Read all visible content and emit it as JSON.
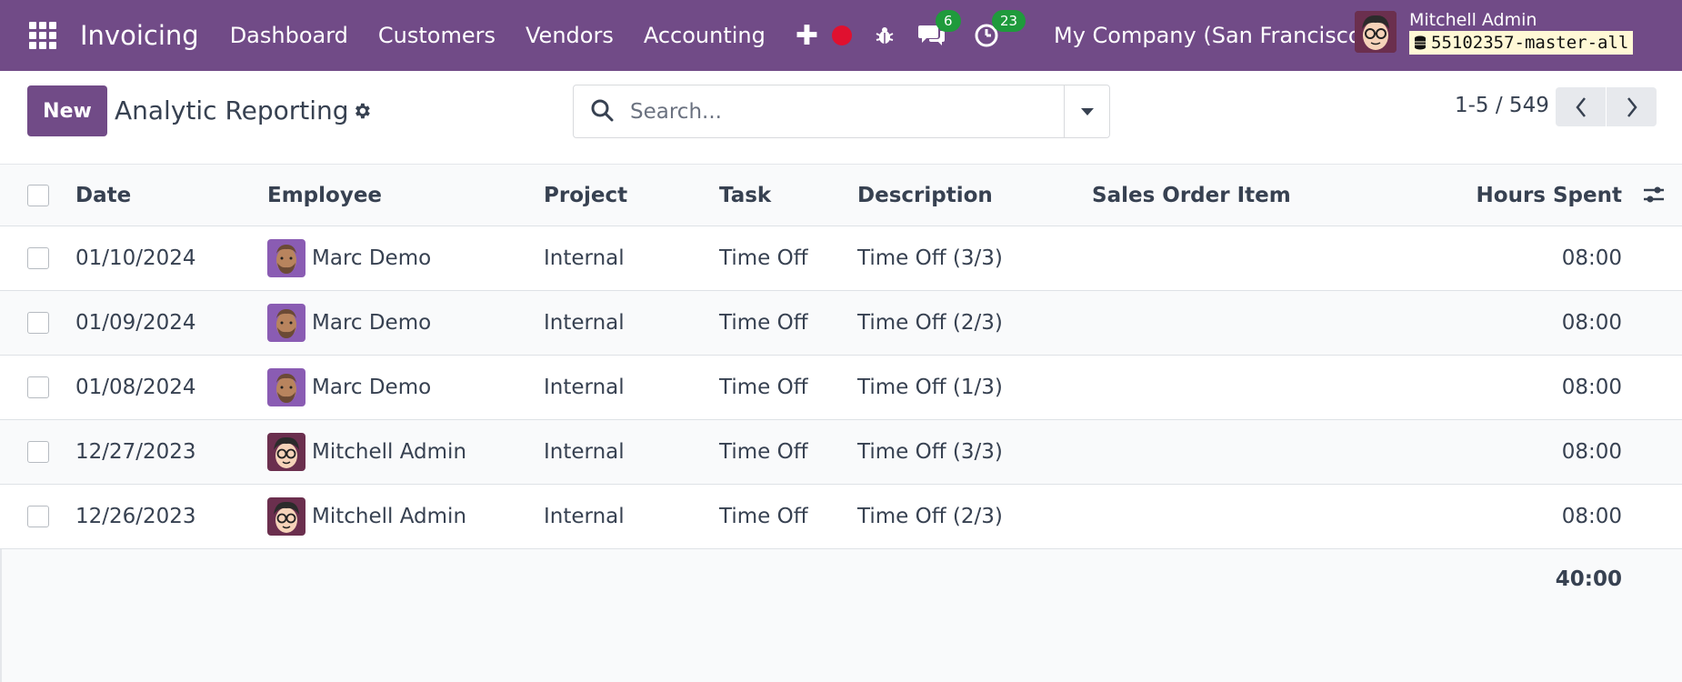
{
  "navbar": {
    "app_name": "Invoicing",
    "menu": [
      "Dashboard",
      "Customers",
      "Vendors",
      "Accounting"
    ],
    "messages_count": "6",
    "activities_count": "23",
    "company": "My Company (San Francisco)",
    "user_name": "Mitchell Admin",
    "database": "55102357-master-all"
  },
  "control": {
    "new_label": "New",
    "title": "Analytic Reporting",
    "search_placeholder": "Search...",
    "pager": "1-5 / 549"
  },
  "table": {
    "headers": {
      "date": "Date",
      "employee": "Employee",
      "project": "Project",
      "task": "Task",
      "description": "Description",
      "sales_order_item": "Sales Order Item",
      "hours_spent": "Hours Spent"
    },
    "rows": [
      {
        "date": "01/10/2024",
        "employee": "Marc Demo",
        "project": "Internal",
        "task": "Time Off",
        "description": "Time Off (3/3)",
        "sales_order_item": "",
        "hours": "08:00"
      },
      {
        "date": "01/09/2024",
        "employee": "Marc Demo",
        "project": "Internal",
        "task": "Time Off",
        "description": "Time Off (2/3)",
        "sales_order_item": "",
        "hours": "08:00"
      },
      {
        "date": "01/08/2024",
        "employee": "Marc Demo",
        "project": "Internal",
        "task": "Time Off",
        "description": "Time Off (1/3)",
        "sales_order_item": "",
        "hours": "08:00"
      },
      {
        "date": "12/27/2023",
        "employee": "Mitchell Admin",
        "project": "Internal",
        "task": "Time Off",
        "description": "Time Off (3/3)",
        "sales_order_item": "",
        "hours": "08:00"
      },
      {
        "date": "12/26/2023",
        "employee": "Mitchell Admin",
        "project": "Internal",
        "task": "Time Off",
        "description": "Time Off (2/3)",
        "sales_order_item": "",
        "hours": "08:00"
      }
    ],
    "total_hours": "40:00"
  },
  "colors": {
    "brand": "#714b87",
    "badge": "#1f9a3c",
    "record": "#e0102f"
  }
}
